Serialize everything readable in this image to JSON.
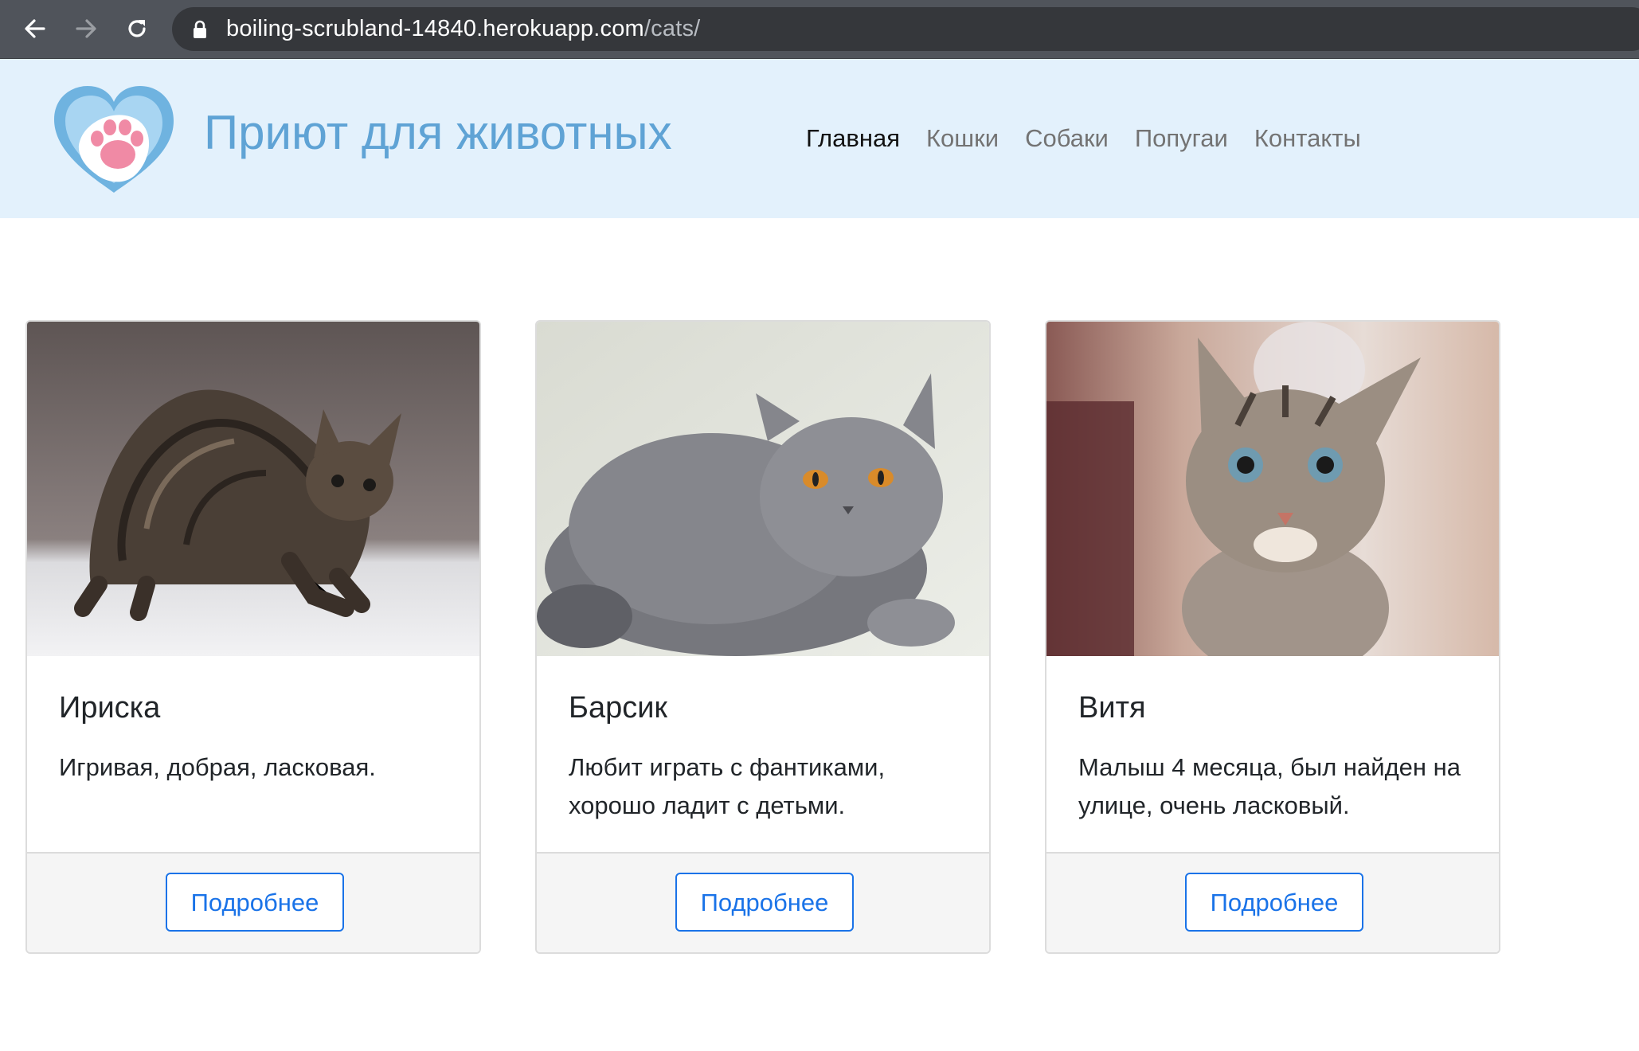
{
  "browser": {
    "url_host": "boiling-scrubland-14840.herokuapp.com",
    "url_path": "/cats/",
    "icons": [
      "back-arrow-icon",
      "forward-arrow-icon",
      "reload-icon",
      "lock-icon"
    ]
  },
  "header": {
    "brand": "Приют для животных",
    "logo_icon": "heart-paw-icon",
    "nav": [
      {
        "label": "Главная",
        "active": true
      },
      {
        "label": "Кошки",
        "active": false
      },
      {
        "label": "Собаки",
        "active": false
      },
      {
        "label": "Попугаи",
        "active": false
      },
      {
        "label": "Контакты",
        "active": false
      }
    ]
  },
  "cards": [
    {
      "name": "Ириска",
      "text": "Игривая, добрая, ласковая.",
      "button": "Подробнее"
    },
    {
      "name": "Барсик",
      "text": "Любит играть с фантиками, хорошо ладит с детьми.",
      "button": "Подробнее"
    },
    {
      "name": "Витя",
      "text": "Малыш 4 месяца, был найден на улице, очень ласковый.",
      "button": "Подробнее"
    }
  ],
  "colors": {
    "header_bg": "#e3f1fc",
    "brand": "#5fa3d5",
    "button_accent": "#1a73e8",
    "chrome_bg": "#50545b"
  }
}
